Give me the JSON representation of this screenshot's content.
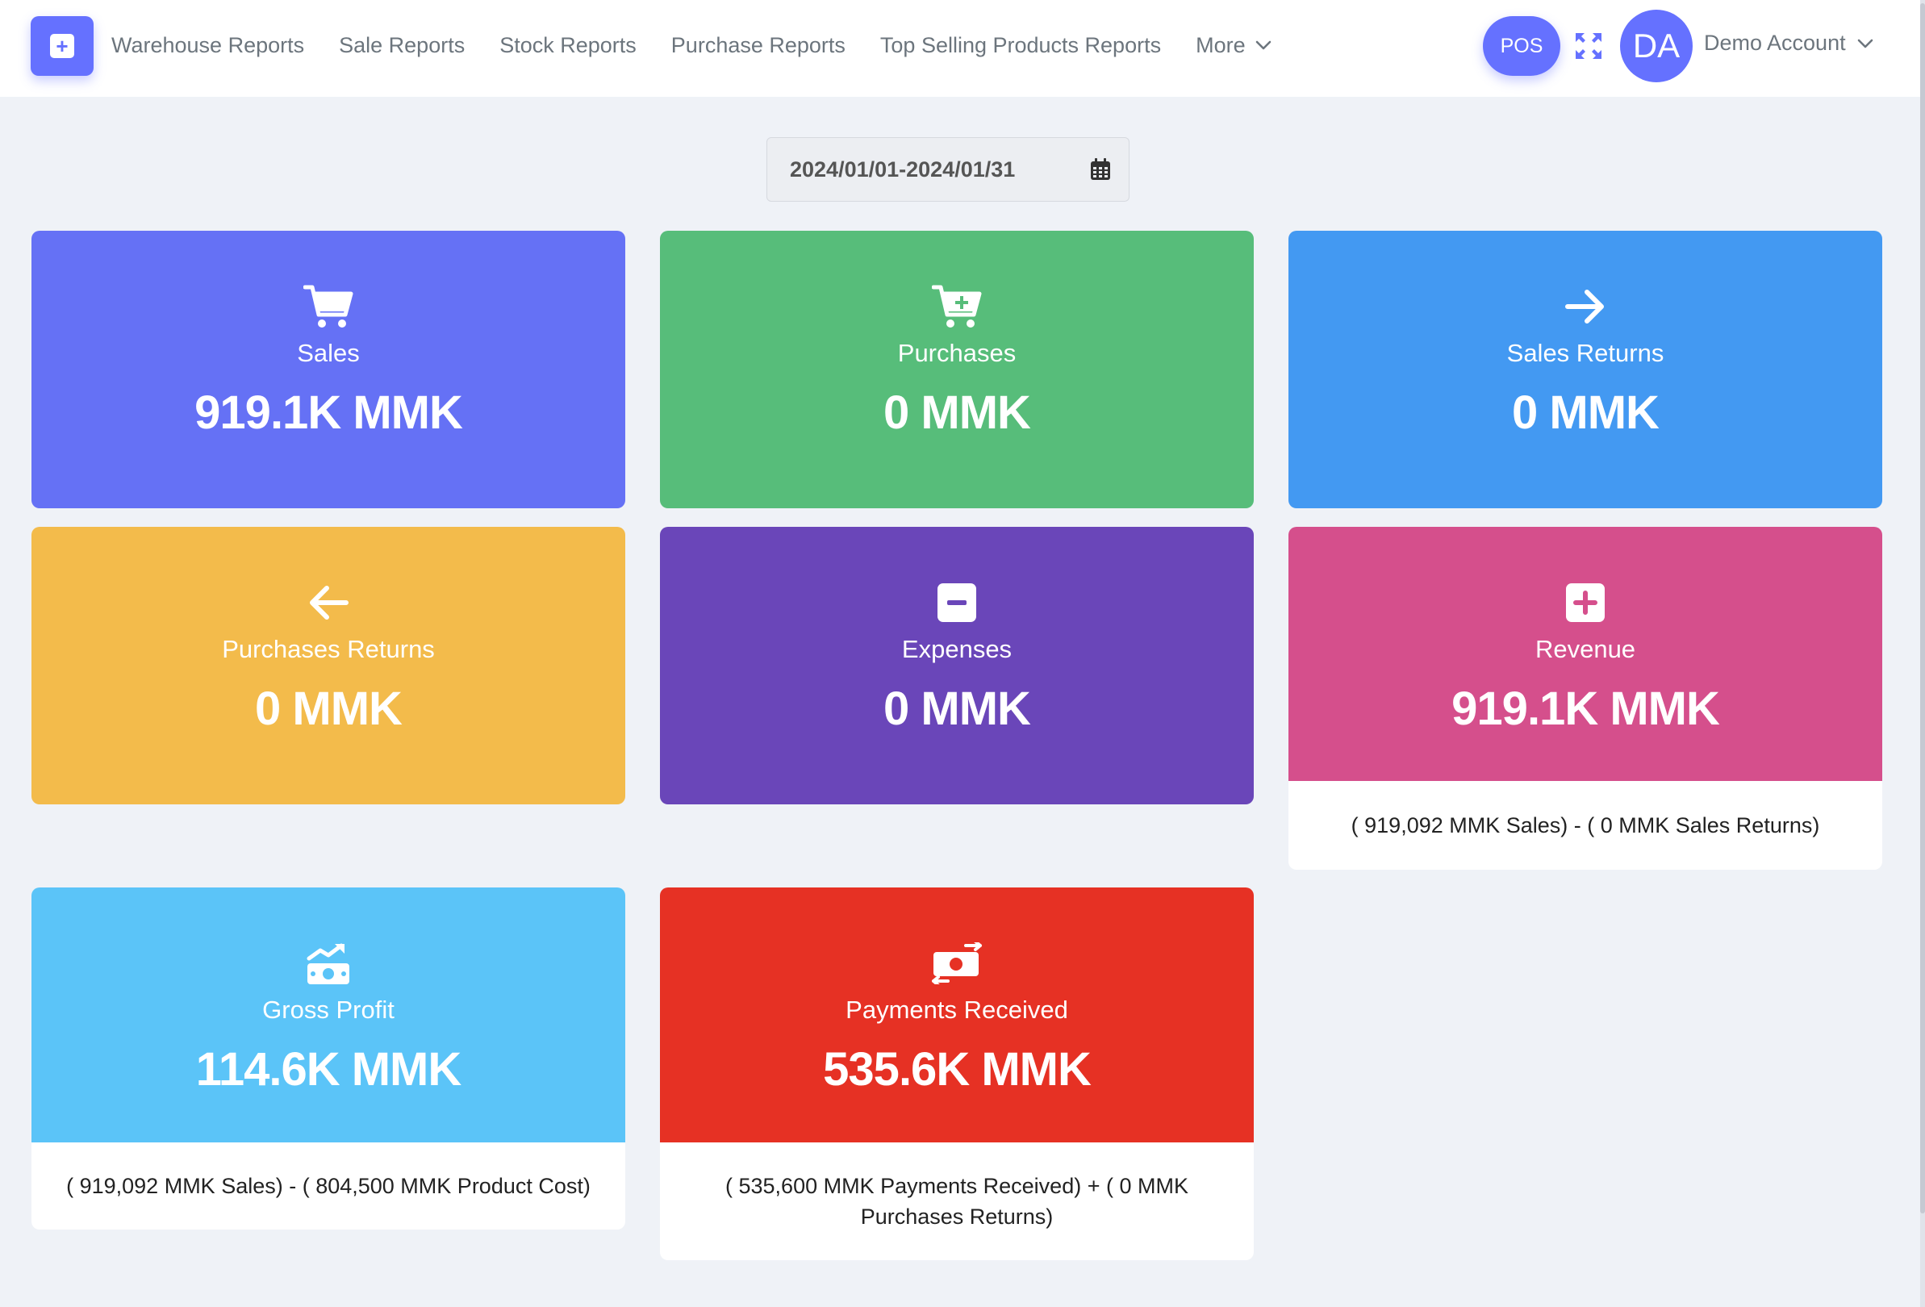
{
  "nav": {
    "items": [
      "Warehouse Reports",
      "Sale Reports",
      "Stock Reports",
      "Purchase Reports",
      "Top Selling Products Reports"
    ],
    "more_label": "More"
  },
  "header": {
    "pos_label": "POS",
    "avatar_initials": "DA",
    "account_name": "Demo Account"
  },
  "filter": {
    "date_range": "2024/01/01-2024/01/31"
  },
  "colors": {
    "accent": "#6571ff",
    "sales": "#6571f5",
    "purchases": "#57bd7a",
    "sales_returns": "#4399f2",
    "purchases_returns": "#f3bb4b",
    "expenses": "#6a46b9",
    "revenue": "#d54f8c",
    "gross_profit": "#5bc4f8",
    "payments_received": "#e63124"
  },
  "cards": {
    "sales": {
      "icon": "cart-icon",
      "label": "Sales",
      "value": "919.1K MMK"
    },
    "purchases": {
      "icon": "cart-plus-icon",
      "label": "Purchases",
      "value": "0 MMK"
    },
    "sales_returns": {
      "icon": "arrow-right-icon",
      "label": "Sales Returns",
      "value": "0 MMK"
    },
    "purchases_returns": {
      "icon": "arrow-left-icon",
      "label": "Purchases Returns",
      "value": "0 MMK"
    },
    "expenses": {
      "icon": "minus-square-icon",
      "label": "Expenses",
      "value": "0 MMK"
    },
    "revenue": {
      "icon": "plus-square-icon",
      "label": "Revenue",
      "value": "919.1K MMK",
      "note": "( 919,092 MMK Sales) - ( 0 MMK Sales Returns)"
    },
    "gross_profit": {
      "icon": "money-chart-icon",
      "label": "Gross Profit",
      "value": "114.6K MMK",
      "note": "( 919,092 MMK Sales) - ( 804,500 MMK Product Cost)"
    },
    "payments_received": {
      "icon": "money-exchange-icon",
      "label": "Payments Received",
      "value": "535.6K MMK",
      "note": "( 535,600 MMK Payments Received) + ( 0 MMK Purchases Returns)"
    }
  }
}
